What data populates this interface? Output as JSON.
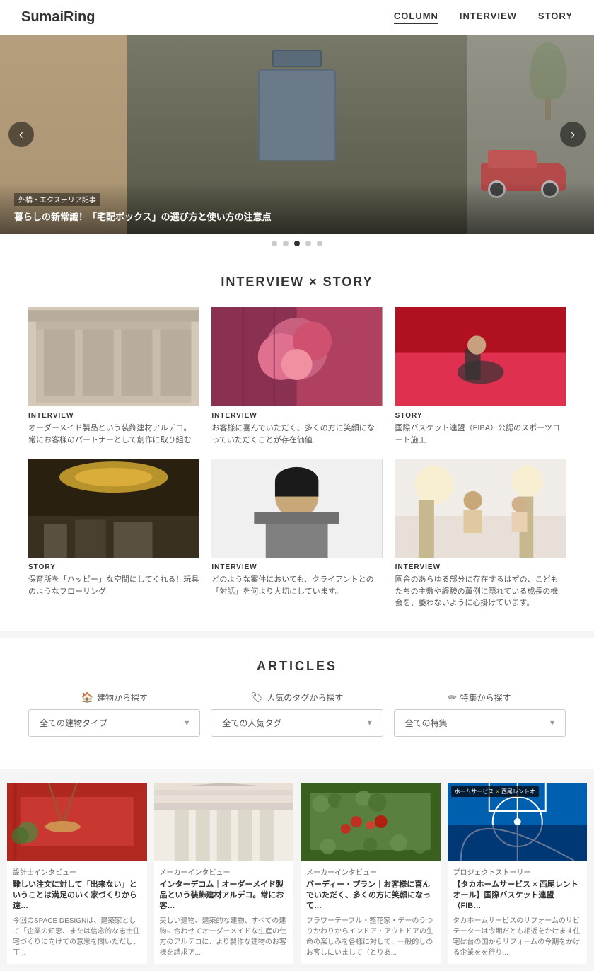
{
  "header": {
    "logo": "SumaiRing",
    "nav": [
      {
        "label": "COLUMN",
        "id": "column",
        "active": true
      },
      {
        "label": "INTERVIEW",
        "id": "interview",
        "active": false
      },
      {
        "label": "STORY",
        "id": "story",
        "active": false
      }
    ]
  },
  "hero": {
    "prev_label": "‹",
    "next_label": "›",
    "slide": {
      "tag": "外構・エクステリア記事",
      "title": "暮らしの新常識！「宅配ボックス」の選び方と使い方の注意点"
    },
    "dots": [
      false,
      false,
      true,
      false,
      false
    ]
  },
  "interview_section": {
    "title": "INTERVIEW × STORY",
    "cards": [
      {
        "category": "INTERVIEW",
        "desc": "オーダーメイド製品という装飾建材アルデコ。常にお客様のパートナーとして創作に取り組む"
      },
      {
        "category": "INTERVIEW",
        "desc": "お客様に喜んでいただく、多くの方に笑顔になっていただくことが存在価値"
      },
      {
        "category": "STORY",
        "desc": "国際バスケット連盟（FIBA）公認のスポーツコート施工"
      },
      {
        "category": "STORY",
        "desc": "保育所を「ハッピー」な空間にしてくれる！玩具のようなフローリング"
      },
      {
        "category": "INTERVIEW",
        "desc": "どのような案件においても、クライアントとの「対話」を何より大切にしています。"
      },
      {
        "category": "INTERVIEW",
        "desc": "園舎のあらゆる部分に存在するはずの、こどもたちの主敷や経験の薫例に隠れている成長の機会を、萎わないように心掛けています。"
      }
    ]
  },
  "articles_section": {
    "title": "ARTICLES",
    "filters": [
      {
        "icon": "🏠",
        "label": "建物から探す",
        "placeholder": "全ての建物タイプ"
      },
      {
        "icon": "🏷",
        "label": "人気のタグから探す",
        "placeholder": "全ての人気タグ"
      },
      {
        "icon": "✏",
        "label": "特集から探す",
        "placeholder": "全ての特集"
      }
    ]
  },
  "bottom_cards": [
    {
      "category": "設計士インタビュー",
      "title": "難しい注文に対して「出来ない」ということは満足のいく家づくりから遠…",
      "desc": "今回のSPACE DESIGNは、建築家として「企業の知恵、または信念的な志士住宅づくりに向けての意思を問いただし、丁..."
    },
    {
      "category": "メーカーインタビュー",
      "title": "インターデコム｜オーダーメイド製品という装飾建材アルデコ。常にお客…",
      "desc": "美しい建物、建築的な建物、すべての建物に合わせてオーダーメイドな生産の仕方のアルデコに、より製作な建物のお客様を請求ア..."
    },
    {
      "category": "メーカーインタビュー",
      "title": "バーディー・プラン｜お客様に喜んでいただく、多くの方に笑顔になって…",
      "desc": "フラワーテーブル・整花家・デーのうつりかわりからインドア・アウトドアの生命の楽しみを各様に対して、一般的しのお客しにいまして（とりあ..."
    },
    {
      "category": "プロジェクトストーリー",
      "title": "【タカホームサービス × 西尾レントオール】国際バスケット連盟（FIB…",
      "desc": "タカホームサービスのリフォームのリビテーターは今期だとも相近をかけます住宅は台の国からリフォームの今期をかける企業をを行り..."
    }
  ]
}
